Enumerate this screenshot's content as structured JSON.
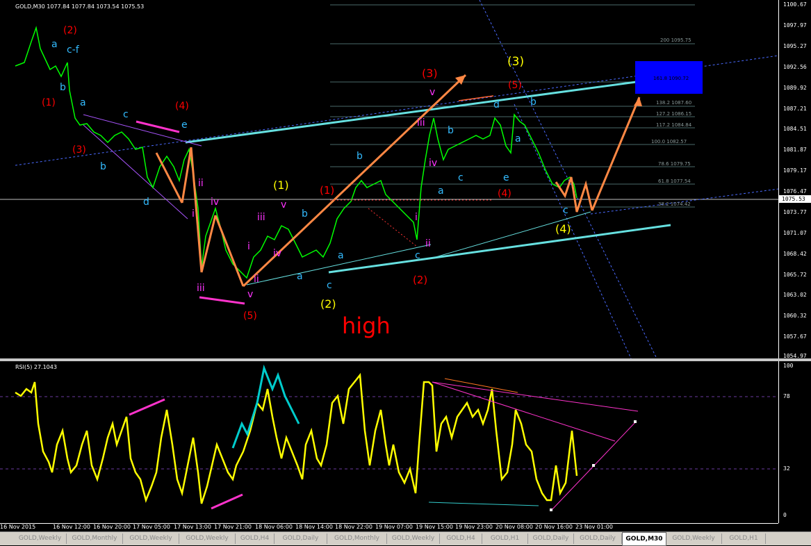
{
  "chart_header": {
    "title": "GOLD,M30  1077.84 1077.84 1073.54 1075.53"
  },
  "rsi_header": {
    "title": "RSI(5) 27.1043"
  },
  "price_scale": [
    "1100.67",
    "1097.97",
    "1095.27",
    "1092.56",
    "1089.92",
    "1087.21",
    "1084.51",
    "1081.87",
    "1079.17",
    "1076.47",
    "1073.77",
    "1071.07",
    "1068.42",
    "1065.72",
    "1063.02",
    "1060.32",
    "1057.67",
    "1054.97"
  ],
  "current_price": "1075.53",
  "rsi_scale": [
    "100",
    "78",
    "32",
    "0"
  ],
  "fib_levels": [
    {
      "label": "200  1095.75"
    },
    {
      "label": "161.8  1090.72"
    },
    {
      "label": "138.2  1087.60"
    },
    {
      "label": "127.2  1086.15"
    },
    {
      "label": "117.2  1084.84"
    },
    {
      "label": "100.0  1082.57"
    },
    {
      "label": "78.6  1079.75"
    },
    {
      "label": "61.8  1077.54"
    },
    {
      "label": "38.2  1074.42"
    }
  ],
  "time_axis": [
    "16 Nov 2015",
    "16 Nov 12:00",
    "16 Nov 20:00",
    "17 Nov 05:00",
    "17 Nov 13:00",
    "17 Nov 21:00",
    "18 Nov 06:00",
    "18 Nov 14:00",
    "18 Nov 22:00",
    "19 Nov 07:00",
    "19 Nov 15:00",
    "19 Nov 23:00",
    "20 Nov 08:00",
    "20 Nov 16:00",
    "23 Nov 01:00"
  ],
  "annotation": {
    "high": "high"
  },
  "wave_labels": [
    {
      "t": "(2)",
      "c": "red"
    },
    {
      "t": "a",
      "c": "cyan"
    },
    {
      "t": "c-f",
      "c": "cyan"
    },
    {
      "t": "b",
      "c": "cyan"
    },
    {
      "t": "(1)",
      "c": "red"
    },
    {
      "t": "a",
      "c": "cyan"
    },
    {
      "t": "c",
      "c": "cyan"
    },
    {
      "t": "(4)",
      "c": "red"
    },
    {
      "t": "e",
      "c": "cyan"
    },
    {
      "t": "(3)",
      "c": "red"
    },
    {
      "t": "b",
      "c": "cyan"
    },
    {
      "t": "d",
      "c": "cyan"
    },
    {
      "t": "ii",
      "c": "mag"
    },
    {
      "t": "iv",
      "c": "mag"
    },
    {
      "t": "i",
      "c": "mag"
    },
    {
      "t": "iii",
      "c": "mag"
    },
    {
      "t": "v",
      "c": "mag"
    },
    {
      "t": "(5)",
      "c": "red"
    },
    {
      "t": "iii",
      "c": "mag"
    },
    {
      "t": "i",
      "c": "mag"
    },
    {
      "t": "iv",
      "c": "mag"
    },
    {
      "t": "ii",
      "c": "mag"
    },
    {
      "t": "(1)",
      "c": "yellow"
    },
    {
      "t": "v",
      "c": "mag"
    },
    {
      "t": "b",
      "c": "cyan"
    },
    {
      "t": "a",
      "c": "cyan"
    },
    {
      "t": "(2)",
      "c": "yellow"
    },
    {
      "t": "(1)",
      "c": "red"
    },
    {
      "t": "a",
      "c": "cyan"
    },
    {
      "t": "c",
      "c": "cyan"
    },
    {
      "t": "b",
      "c": "cyan"
    },
    {
      "t": "(2)",
      "c": "red"
    },
    {
      "t": "c",
      "c": "cyan"
    },
    {
      "t": "ii",
      "c": "mag"
    },
    {
      "t": "i",
      "c": "mag"
    },
    {
      "t": "(3)",
      "c": "red"
    },
    {
      "t": "v",
      "c": "mag"
    },
    {
      "t": "iii",
      "c": "mag"
    },
    {
      "t": "iv",
      "c": "mag"
    },
    {
      "t": "b",
      "c": "cyan"
    },
    {
      "t": "a",
      "c": "cyan"
    },
    {
      "t": "c",
      "c": "cyan"
    },
    {
      "t": "(4)",
      "c": "red"
    },
    {
      "t": "(3)",
      "c": "yellow"
    },
    {
      "t": "(5)",
      "c": "red"
    },
    {
      "t": "d",
      "c": "cyan"
    },
    {
      "t": "b",
      "c": "cyan"
    },
    {
      "t": "a",
      "c": "cyan"
    },
    {
      "t": "e",
      "c": "cyan"
    },
    {
      "t": "c",
      "c": "cyan"
    },
    {
      "t": "(4)",
      "c": "yellow"
    }
  ],
  "tabs": [
    {
      "label": "GOLD,Weekly"
    },
    {
      "label": "GOLD,Monthly"
    },
    {
      "label": "GOLD,Weekly"
    },
    {
      "label": "GOLD,Weekly"
    },
    {
      "label": "GOLD,H4"
    },
    {
      "label": "GOLD,Daily"
    },
    {
      "label": "GOLD,Monthly"
    },
    {
      "label": "GOLD,Weekly"
    },
    {
      "label": "GOLD,H4"
    },
    {
      "label": "GOLD,H1"
    },
    {
      "label": "GOLD,Daily"
    },
    {
      "label": "GOLD,Daily"
    },
    {
      "label": "GOLD,M30"
    },
    {
      "label": "GOLD,Weekly"
    },
    {
      "label": "GOLD,H1"
    }
  ],
  "colors": {
    "background": "#000000",
    "candles": "#00ff00",
    "rsi_line": "#ffff00",
    "channel": "#66e0e0",
    "arrows": "#ff8844",
    "target_box": "#0000ff"
  }
}
